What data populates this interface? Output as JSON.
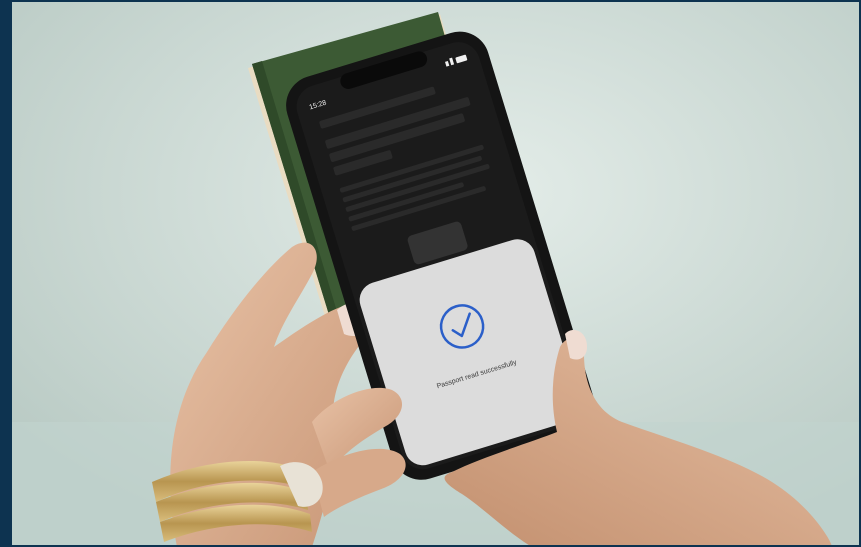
{
  "scene": {
    "status_time": "15:28",
    "sheet_message": "Passport read successfully",
    "check_icon": "checkmark-circle-icon",
    "colors": {
      "frame": "#0d3350",
      "passport_cover": "#3c5a34",
      "phone_body": "#141414",
      "sheet": "#dcdcdc",
      "check_accent": "#2b5fc9"
    }
  }
}
